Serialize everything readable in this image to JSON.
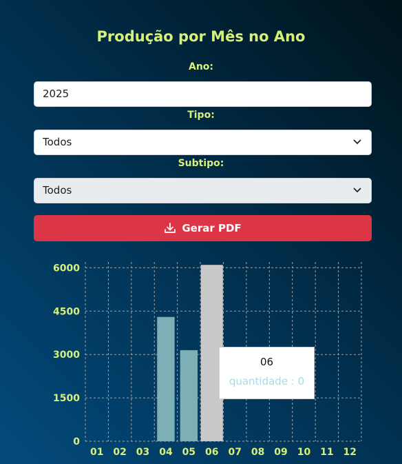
{
  "title": "Produção por Mês no Ano",
  "filters": {
    "year_label": "Ano:",
    "year_value": "2025",
    "type_label": "Tipo:",
    "type_value": "Todos",
    "subtype_label": "Subtipo:",
    "subtype_value": "Todos"
  },
  "export_button": {
    "label": "Gerar PDF",
    "icon": "download-icon"
  },
  "colors": {
    "label_accent": "#d7f07a",
    "button": "#dc3545",
    "bar": "#7fafb6",
    "bar_active": "#c9c9c9",
    "tooltip_value": "#a7dbe6"
  },
  "tooltip": {
    "label": "06",
    "value_text": "quantidade : 0"
  },
  "chart_data": {
    "type": "bar",
    "categories": [
      "01",
      "02",
      "03",
      "04",
      "05",
      "06",
      "07",
      "08",
      "09",
      "10",
      "11",
      "12"
    ],
    "series": [
      {
        "name": "quantidade",
        "values": [
          0,
          0,
          0,
          4300,
          3150,
          6100,
          0,
          0,
          0,
          0,
          0,
          0
        ]
      }
    ],
    "yticks": [
      0,
      1500,
      3000,
      4500,
      6000
    ],
    "ylim": [
      0,
      6200
    ],
    "grid": true,
    "active_category": "06"
  }
}
